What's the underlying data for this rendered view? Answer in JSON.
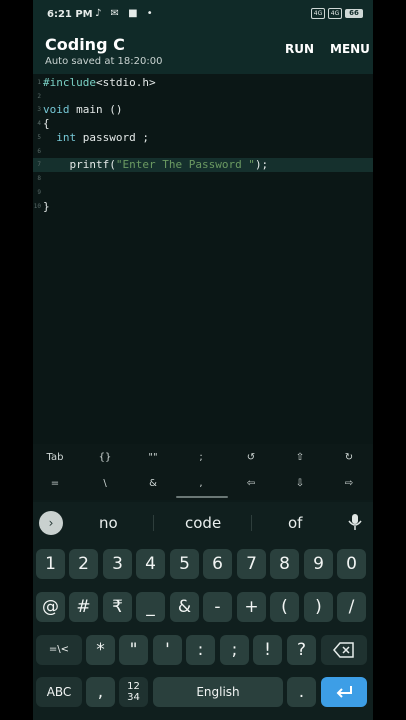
{
  "status_bar": {
    "time": "6:21 PM",
    "icons_text": "♪ ✉ ■ •",
    "sim1": "4G",
    "sim2": "4G",
    "battery": "66"
  },
  "app_bar": {
    "title": "Coding C",
    "subtitle": "Auto saved at 18:20:00",
    "run_label": "RUN",
    "menu_label": "MENU"
  },
  "editor": {
    "line_numbers": [
      "1",
      "2",
      "3",
      "4",
      "5",
      "6",
      "7",
      "8",
      "9",
      "10"
    ],
    "include_kw": "#include",
    "include_rest": "<stdio.h>",
    "void_kw": "void",
    "main_rest": " main ()",
    "open_brace": "{",
    "int_indent": "  ",
    "int_kw": "int",
    "password_decl": " password ;",
    "printf_head": "    printf(",
    "printf_str": "\"Enter The Password \"",
    "printf_tail": ");",
    "close_brace": "}"
  },
  "extra_keys": {
    "row1": [
      "Tab",
      "{}",
      "\"\"",
      ";",
      "↺",
      "⇧",
      "↻"
    ],
    "row2": [
      "=",
      "\\",
      "&",
      ",",
      "⇦",
      "⇩",
      "⇨"
    ]
  },
  "keyboard": {
    "suggestions": [
      "no",
      "code",
      "of"
    ],
    "number_row": [
      "1",
      "2",
      "3",
      "4",
      "5",
      "6",
      "7",
      "8",
      "9",
      "0"
    ],
    "symbol_row1": [
      "@",
      "#",
      "₹",
      "_",
      "&",
      "-",
      "+",
      "(",
      ")",
      "/"
    ],
    "symbol_row2_switch": "=\\<",
    "symbol_row2": [
      "*",
      "\"",
      "'",
      ":",
      ";",
      "!",
      "?"
    ],
    "abc": "ABC",
    "comma": ",",
    "numpad_top": "12",
    "numpad_bottom": "34",
    "space": "English",
    "period": "."
  },
  "colors": {
    "background": "#0b1716",
    "app_bar": "#102a28",
    "keyboard": "#101f1e",
    "key": "#2a403d",
    "enter": "#3d9ee6",
    "string": "#6b9a62",
    "keyword": "#76c8d6"
  }
}
